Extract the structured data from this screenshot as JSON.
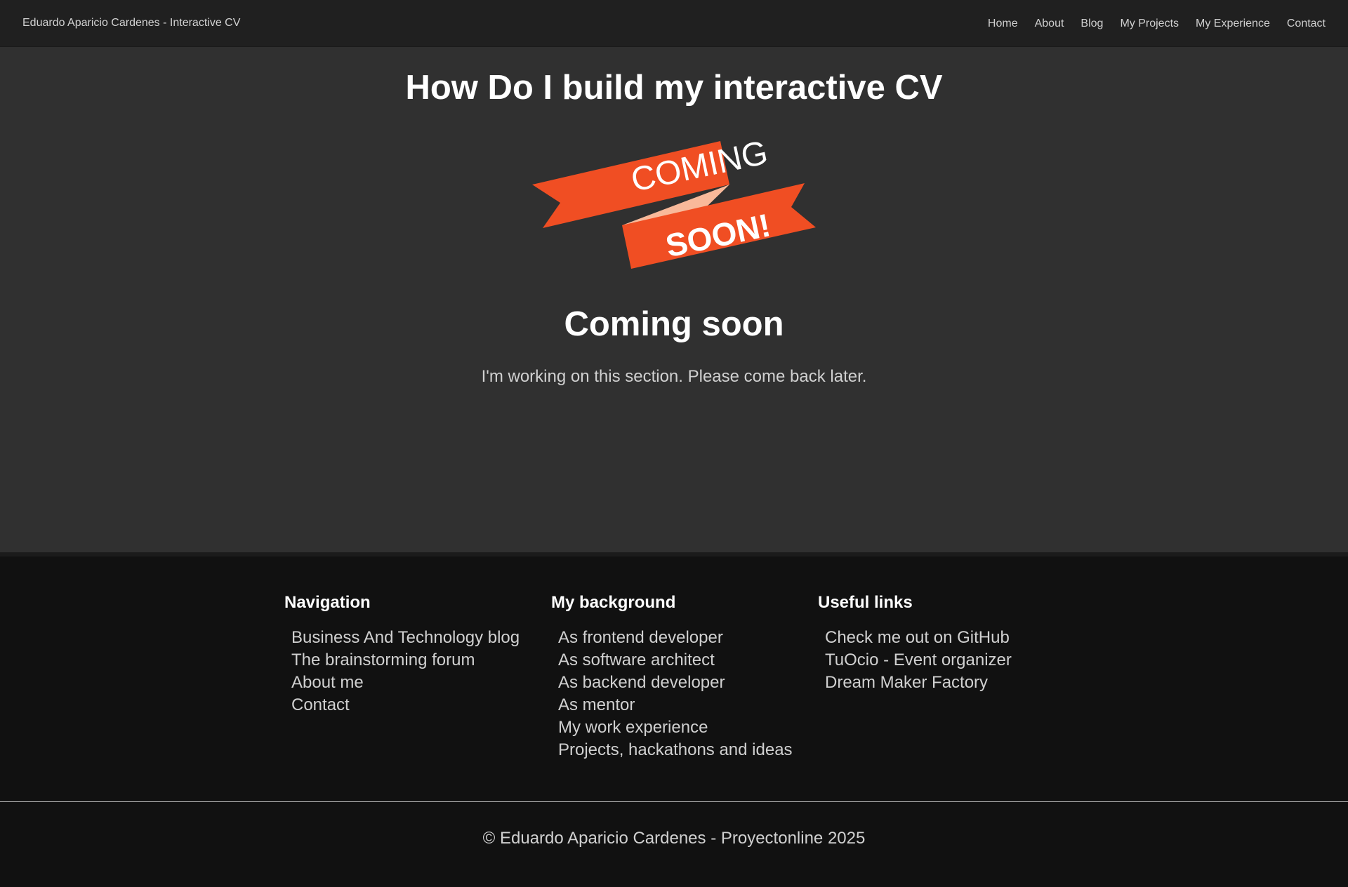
{
  "navbar": {
    "brand": "Eduardo Aparicio Cardenes - Interactive CV",
    "links": [
      "Home",
      "About",
      "Blog",
      "My Projects",
      "My Experience",
      "Contact"
    ]
  },
  "main": {
    "page_title": "How Do I build my interactive CV",
    "banner": {
      "line1": "COMING",
      "line2": "SOON!",
      "colors": {
        "ribbon": "#f04e23",
        "fold": "#f9b99a",
        "text": "#ffffff"
      }
    },
    "section_title": "Coming soon",
    "section_text": "I'm working on this section. Please come back later."
  },
  "footer": {
    "columns": [
      {
        "heading": "Navigation",
        "items": [
          "Business And Technology blog",
          "The brainstorming forum",
          "About me",
          "Contact"
        ]
      },
      {
        "heading": "My background",
        "items": [
          "As frontend developer",
          "As software architect",
          "As backend developer",
          "As mentor",
          "My work experience",
          "Projects, hackathons and ideas"
        ]
      },
      {
        "heading": "Useful links",
        "items": [
          "Check me out on GitHub",
          "TuOcio - Event organizer",
          "Dream Maker Factory"
        ]
      }
    ],
    "copyright": "© Eduardo Aparicio Cardenes - Proyectonline 2025"
  },
  "colors": {
    "navbar_bg": "#202020",
    "main_bg": "#303030",
    "footer_bg": "#111111",
    "accent": "#f04e23"
  }
}
